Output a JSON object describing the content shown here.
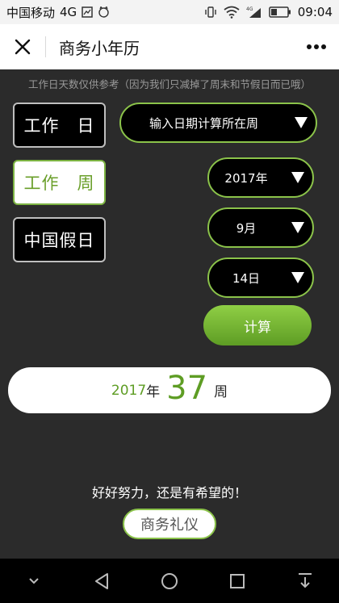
{
  "statusbar": {
    "carrier": "中国移动",
    "network": "4G",
    "time": "09:04",
    "net_small": "4G"
  },
  "header": {
    "title": "商务小年历",
    "more": "•••"
  },
  "notice": "工作日天数仅供参考（因为我们只减掉了周末和节假日而已哦）",
  "side": {
    "workday": [
      "工作",
      "日"
    ],
    "workweek": [
      "工作",
      "周"
    ],
    "holiday": "中国假日"
  },
  "selects": {
    "date_mode": "输入日期计算所在周",
    "year": "2017年",
    "month": "9月",
    "day": "14日"
  },
  "calc_label": "计算",
  "result": {
    "year": "2017",
    "year_unit": "年",
    "week": "37",
    "week_unit": "周"
  },
  "motto": "好好努力，还是有希望的！",
  "ceremony_label": "商务礼仪",
  "colors": {
    "accent": "#8bc34a",
    "accent_dark": "#5e9d24",
    "background": "#2b2b2b"
  }
}
